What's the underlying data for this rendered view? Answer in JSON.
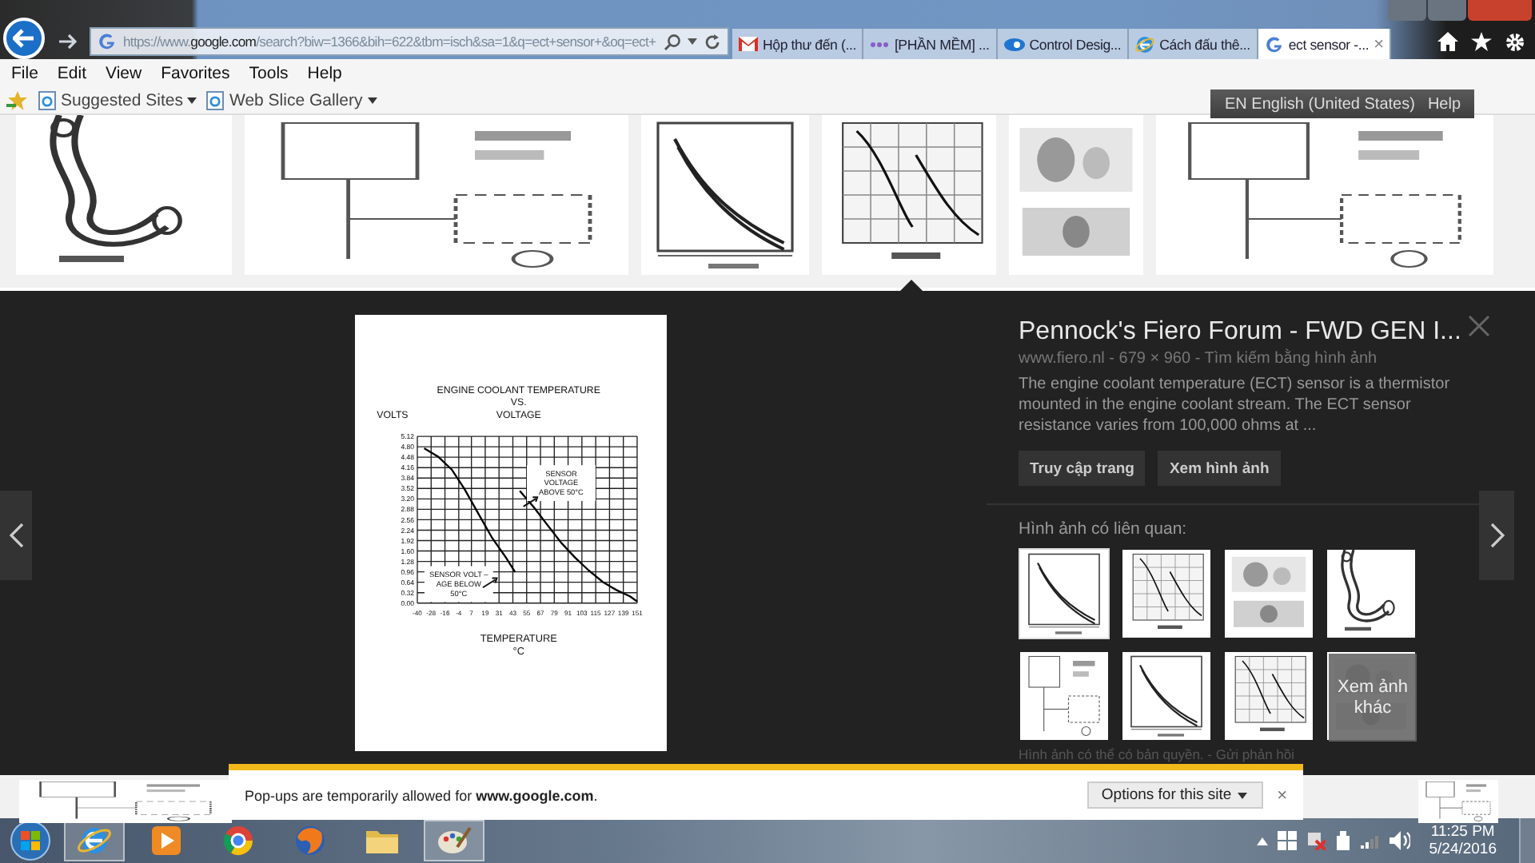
{
  "browser": {
    "address": "https://www.**google.com**/search?biw=1366&bih=622&tbm=isch&sa=1&q=ect+sensor+&oq=ect+",
    "tabs": [
      {
        "label": "Hộp thư đến (...",
        "kind": "mail",
        "selected": false
      },
      {
        "label": "[PHẦN MỀM] ...",
        "kind": "dots",
        "selected": false
      },
      {
        "label": "Control Desig...",
        "kind": "eye",
        "selected": false
      },
      {
        "label": "Cách đấu thê...",
        "kind": "ie",
        "selected": false
      },
      {
        "label": "ect sensor -...",
        "kind": "g",
        "selected": true,
        "close": "×"
      }
    ],
    "menu": [
      "File",
      "Edit",
      "View",
      "Favorites",
      "Tools",
      "Help"
    ],
    "favorites": [
      "Suggested Sites",
      "Web Slice Gallery"
    ],
    "language_bar": {
      "language": "EN English (United States)",
      "help": "Help"
    }
  },
  "preview": {
    "title": "Pennock's Fiero Forum - FWD GEN I...",
    "meta": "www.fiero.nl - 679 × 960 - Tìm kiếm bằng hình ảnh",
    "description": "The engine coolant temperature (ECT) sensor is a thermistor mounted in the engine coolant stream. The ECT sensor resistance varies from 100,000 ohms at ...",
    "buttons": [
      "Truy cập trang",
      "Xem hình ảnh"
    ],
    "related_label": "Hình ảnh có liên quan:",
    "related": [
      {
        "selected": true
      },
      {
        "selected": false
      },
      {
        "selected": false
      },
      {
        "selected": false
      },
      {
        "selected": false
      },
      {
        "selected": false
      },
      {
        "selected": false
      },
      {
        "selected": false
      }
    ],
    "more_label": "Xem ảnh khác",
    "footer": "Hình ảnh có thể có bản quyền. - Gửi phản hồi",
    "chart_data": {
      "type": "line",
      "title": "ENGINE COOLANT TEMPERATURE\nVS.\nVOLTAGE",
      "xlabel": "TEMPERATURE\n°C",
      "ylabel": "VOLTS",
      "x": [
        -34,
        -22,
        -10,
        1,
        13,
        25,
        37,
        45,
        49,
        61,
        73,
        85,
        97,
        109,
        121,
        133,
        145,
        151
      ],
      "series": [
        {
          "color": "#000000",
          "values": [
            4.75,
            4.5,
            4.1,
            3.5,
            2.75,
            2.0,
            1.4,
            0.95,
            null,
            null,
            null,
            null,
            null,
            null,
            null,
            null,
            null,
            null
          ]
        },
        {
          "color": "#000000",
          "values": [
            null,
            null,
            null,
            null,
            null,
            null,
            null,
            null,
            3.45,
            2.95,
            2.4,
            1.85,
            1.4,
            1.0,
            0.65,
            0.4,
            0.2,
            0.05
          ]
        }
      ],
      "grid": true,
      "xlim": [
        -40,
        151
      ],
      "ylim": [
        0,
        5.12
      ],
      "xticks": [
        -40,
        -28,
        -16,
        -4,
        7,
        19,
        31,
        43,
        55,
        67,
        79,
        91,
        103,
        115,
        127,
        139,
        151
      ],
      "yticks": [
        {
          "value": 0,
          "label": "0.00"
        },
        {
          "value": 0.32,
          "label": "0.32"
        },
        {
          "value": 0.64,
          "label": "0.64"
        },
        {
          "value": 0.96,
          "label": "0.96"
        },
        {
          "value": 1.28,
          "label": "1.28"
        },
        {
          "value": 1.6,
          "label": "1.60"
        },
        {
          "value": 1.92,
          "label": "1.92"
        },
        {
          "value": 2.24,
          "label": "2.24"
        },
        {
          "value": 2.56,
          "label": "2.56"
        },
        {
          "value": 2.88,
          "label": "2.88"
        },
        {
          "value": 3.2,
          "label": "3.20"
        },
        {
          "value": 3.52,
          "label": "3.52"
        },
        {
          "value": 3.84,
          "label": "3.84"
        },
        {
          "value": 4.16,
          "label": "4.16"
        },
        {
          "value": 4.48,
          "label": "4.48"
        },
        {
          "value": 4.8,
          "label": "4.80"
        },
        {
          "value": 5.12,
          "label": "5.12"
        }
      ],
      "annotations": [
        "SENSOR\nVOLTAGE\nABOVE 50°C",
        "SENSOR VOLT –\nAGE BELOW\n50°C"
      ]
    }
  },
  "popup": {
    "message": "Pop-ups are temporarily allowed for **www.google.com**.",
    "options": "Options for this site",
    "close": "×"
  },
  "taskbar": {
    "time": "11:25 PM",
    "date": "5/24/2016"
  }
}
